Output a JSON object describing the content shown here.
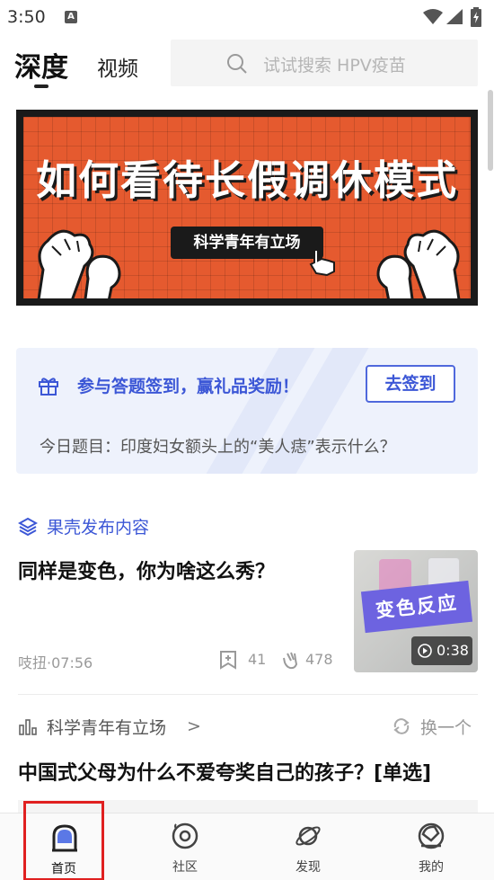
{
  "status_bar": {
    "time": "3:50",
    "app_indicator": "A"
  },
  "header": {
    "tabs": [
      {
        "label": "深度",
        "active": true
      },
      {
        "label": "视频",
        "active": false
      }
    ],
    "search_placeholder": "试试搜索 HPV疫苗"
  },
  "banner": {
    "title": "如何看待长假调休模式",
    "tag": "科学青年有立场"
  },
  "signin_card": {
    "promo_text": "参与答题签到，赢礼品奖励！",
    "button_label": "去签到",
    "question": "今日题目：印度妇女额头上的“美人痣”表示什么？"
  },
  "feed": {
    "item1": {
      "source": "果壳发布内容",
      "title": "同样是变色，你为啥这么秀？",
      "author_time": "吱扭·07:56",
      "saves": "41",
      "likes": "478",
      "thumb_label": "变色反应",
      "duration": "0:38"
    },
    "item2": {
      "source": "科学青年有立场",
      "source_chevron": ">",
      "swap_label": "换一个",
      "title": "中国式父母为什么不爱夸奖自己的孩子？[单选]"
    }
  },
  "bottom_nav": [
    {
      "label": "首页",
      "icon": "home-helmet-icon",
      "active": true
    },
    {
      "label": "社区",
      "icon": "community-disc-icon",
      "active": false
    },
    {
      "label": "发现",
      "icon": "discover-planet-icon",
      "active": false
    },
    {
      "label": "我的",
      "icon": "profile-helmet-icon",
      "active": false
    }
  ],
  "colors": {
    "accent": "#3c57d6",
    "banner": "#e55a2f",
    "highlight_box": "#e02020"
  }
}
